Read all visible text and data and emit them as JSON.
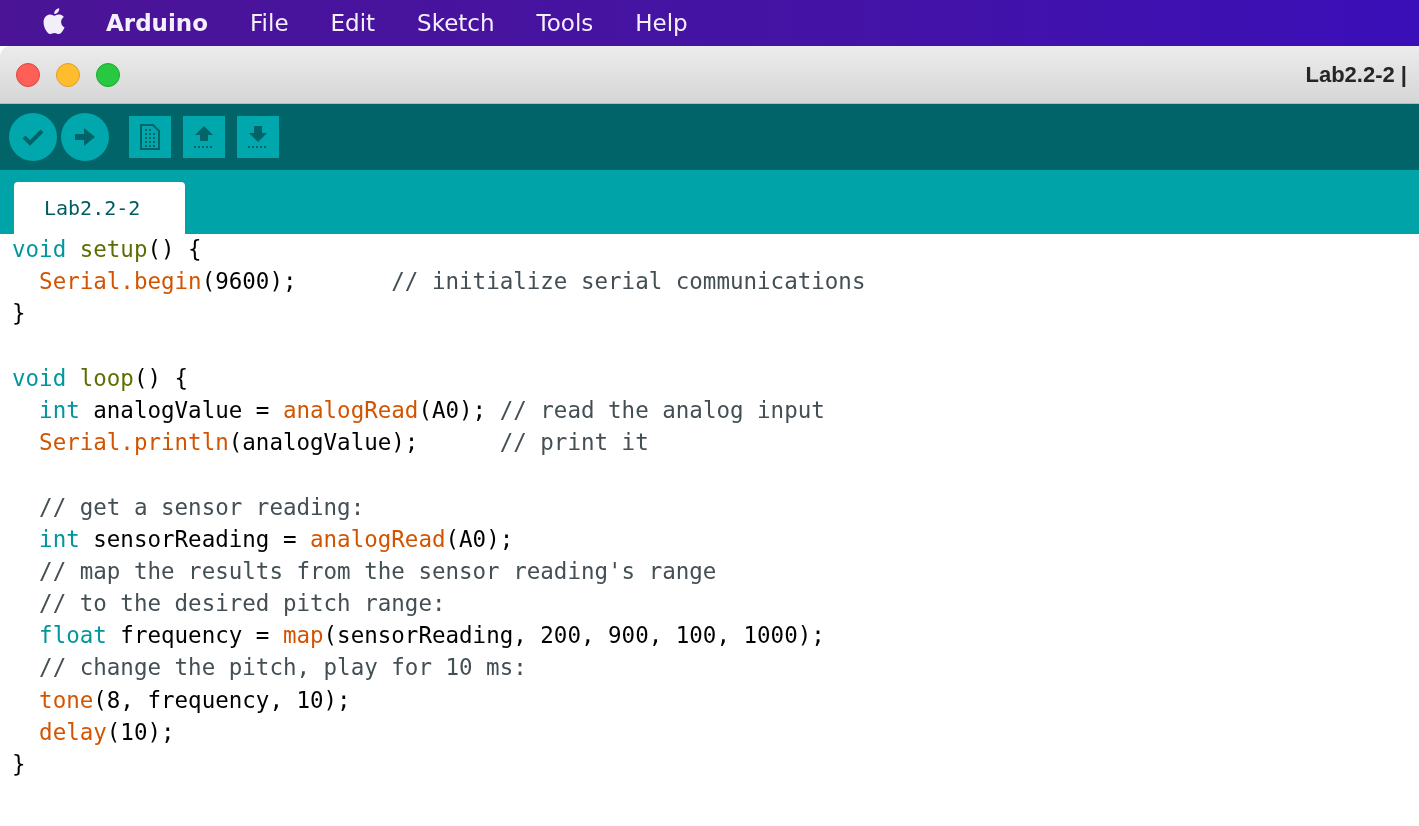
{
  "menu_bar": {
    "app_name": "Arduino",
    "items": [
      "File",
      "Edit",
      "Sketch",
      "Tools",
      "Help"
    ]
  },
  "window": {
    "title": "Lab2.2-2 |"
  },
  "tabs": [
    {
      "label": "Lab2.2-2",
      "selected": true
    }
  ],
  "editor": {
    "lines": [
      {
        "kind": "code",
        "tokens": [
          {
            "text": "void ",
            "kind": "type"
          },
          {
            "text": "setup",
            "kind": "func"
          },
          {
            "text": "() {",
            "kind": "plain"
          }
        ]
      },
      {
        "kind": "code",
        "tokens": [
          {
            "text": "  Serial.begin",
            "kind": "lib"
          },
          {
            "text": "(9600);       ",
            "kind": "plain"
          },
          {
            "text": "// initialize serial communications",
            "kind": "comment"
          }
        ]
      },
      {
        "kind": "code",
        "tokens": [
          {
            "text": "}",
            "kind": "plain"
          }
        ]
      },
      {
        "kind": "blank"
      },
      {
        "kind": "code",
        "tokens": [
          {
            "text": "void ",
            "kind": "type"
          },
          {
            "text": "loop",
            "kind": "func"
          },
          {
            "text": "() {",
            "kind": "plain"
          }
        ]
      },
      {
        "kind": "code",
        "tokens": [
          {
            "text": "  int",
            "kind": "type"
          },
          {
            "text": " analogValue = ",
            "kind": "plain"
          },
          {
            "text": "analogRead",
            "kind": "lib"
          },
          {
            "text": "(A0); ",
            "kind": "plain"
          },
          {
            "text": "// read the analog input",
            "kind": "comment"
          }
        ]
      },
      {
        "kind": "code",
        "tokens": [
          {
            "text": "  Serial.println",
            "kind": "lib"
          },
          {
            "text": "(analogValue);      ",
            "kind": "plain"
          },
          {
            "text": "// print it",
            "kind": "comment"
          }
        ]
      },
      {
        "kind": "blank"
      },
      {
        "kind": "code",
        "tokens": [
          {
            "text": "  // get a sensor reading:",
            "kind": "comment"
          }
        ]
      },
      {
        "kind": "code",
        "tokens": [
          {
            "text": "  int",
            "kind": "type"
          },
          {
            "text": " sensorReading = ",
            "kind": "plain"
          },
          {
            "text": "analogRead",
            "kind": "lib"
          },
          {
            "text": "(A0);",
            "kind": "plain"
          }
        ]
      },
      {
        "kind": "code",
        "tokens": [
          {
            "text": "  // map the results from the sensor reading's range",
            "kind": "comment"
          }
        ]
      },
      {
        "kind": "code",
        "tokens": [
          {
            "text": "  // to the desired pitch range:",
            "kind": "comment"
          }
        ]
      },
      {
        "kind": "code",
        "tokens": [
          {
            "text": "  float",
            "kind": "type"
          },
          {
            "text": " frequency = ",
            "kind": "plain"
          },
          {
            "text": "map",
            "kind": "lib"
          },
          {
            "text": "(sensorReading, 200, 900, 100, 1000);",
            "kind": "plain"
          }
        ]
      },
      {
        "kind": "code",
        "tokens": [
          {
            "text": "  // change the pitch, play for 10 ms:",
            "kind": "comment"
          }
        ]
      },
      {
        "kind": "code",
        "tokens": [
          {
            "text": "  tone",
            "kind": "lib"
          },
          {
            "text": "(8, frequency, 10);",
            "kind": "plain"
          }
        ]
      },
      {
        "kind": "code",
        "tokens": [
          {
            "text": "  delay",
            "kind": "lib"
          },
          {
            "text": "(10);",
            "kind": "plain"
          }
        ]
      },
      {
        "kind": "code",
        "tokens": [
          {
            "text": "}",
            "kind": "plain"
          }
        ]
      }
    ]
  }
}
